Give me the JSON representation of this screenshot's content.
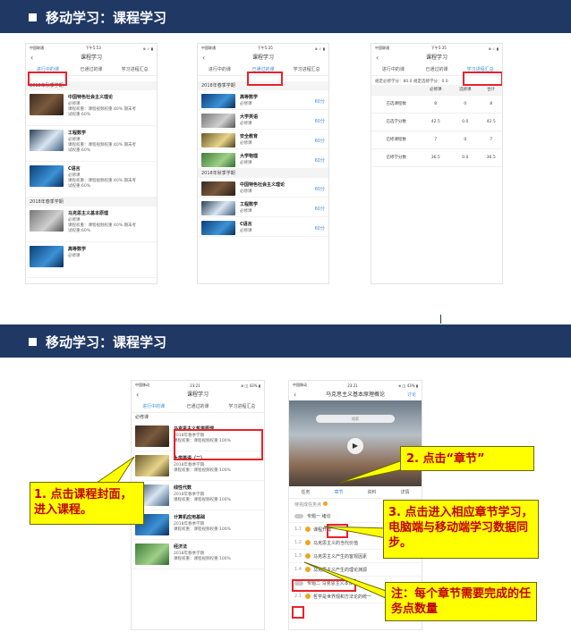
{
  "slide1": {
    "title": "移动学习：课程学习",
    "phone1": {
      "status_left": "中国联通",
      "status_time": "下午5:53",
      "status_right": "⊕ ✓ ▮",
      "nav_title": "课程学习",
      "tabs": [
        "进行中的课",
        "已通过的课",
        "学习进程汇总"
      ],
      "sections": [
        {
          "label": "2018年秋季学期",
          "items": [
            {
              "name": "中国特色社会主义理论",
              "type": "必修课",
              "weight": "课程权重：课程视频权重:40% 期末考",
              "weight2": "试权重:60%",
              "thumb_text": "理论体系概论"
            },
            {
              "name": "工程数学",
              "type": "必修课",
              "weight": "课程权重：课程视频权重:40% 期末考",
              "weight2": "试权重:60%"
            },
            {
              "name": "C语言",
              "type": "必修课",
              "weight": "课程权重：课程视频权重:40% 期末考",
              "weight2": "试权重:60%"
            }
          ]
        },
        {
          "label": "2018年春季学期",
          "items": [
            {
              "name": "马克思主义基本原理",
              "type": "必修课",
              "weight": "课程权重：课程视频权重:40% 期末考",
              "weight2": "试权重:60%",
              "thumb_text": "马克思主义"
            },
            {
              "name": "高等数学",
              "type": "必修课",
              "weight": "",
              "weight2": ""
            }
          ]
        }
      ]
    },
    "phone2": {
      "status_left": "中国联通",
      "status_time": "下午5:35",
      "status_right": "⊕ ✓ ▮",
      "nav_title": "课程学习",
      "tabs": [
        "进行中的课",
        "已通过的课",
        "学习进程汇总"
      ],
      "sections": [
        {
          "label": "2018年春季学期",
          "items": [
            {
              "name": "高等数学",
              "type": "必修课",
              "score": "60分"
            },
            {
              "name": "大学英语",
              "type": "必修课",
              "score": "60分"
            },
            {
              "name": "安全教育",
              "type": "必修课",
              "score": "60分"
            },
            {
              "name": "大学物理",
              "type": "必修课",
              "score": "60分"
            }
          ]
        },
        {
          "label": "2018年秋季学期",
          "items": [
            {
              "name": "中国特色社会主义理论",
              "type": "必修课",
              "score": "60分"
            },
            {
              "name": "工程数学",
              "type": "必修课",
              "score": "60分"
            },
            {
              "name": "C语言",
              "type": "必修课",
              "score": "60分"
            }
          ]
        }
      ]
    },
    "phone3": {
      "status_left": "中国联通",
      "status_time": "下午5:35",
      "status_right": "⊕ ✓ ▮",
      "nav_title": "课程学习",
      "tabs": [
        "进行中的课",
        "已通过的课",
        "学习进程汇总"
      ],
      "summary": "规定必修学分：80.0    规定选修学分：0.0",
      "table": {
        "headers": [
          "",
          "必修课",
          "选修课",
          "合计"
        ],
        "rows": [
          [
            "已选课程数",
            "8",
            "0",
            "8"
          ],
          [
            "已选学分数",
            "42.5",
            "0.0",
            "42.5"
          ],
          [
            "已修课程数",
            "7",
            "0",
            "7"
          ],
          [
            "已修学分数",
            "36.5",
            "0.0",
            "36.5"
          ]
        ]
      }
    }
  },
  "slide2": {
    "title": "移动学习：课程学习",
    "phone4": {
      "status_left": "中国移动",
      "status_time": "23:21",
      "status_right": "⊕ ◫ 43% ▮",
      "nav_title": "课程学习",
      "tabs": [
        "进行中的课",
        "已通过的课",
        "学习进程汇总"
      ],
      "section": "必修课",
      "items": [
        {
          "name": "马克思主义哲学原理",
          "term": "2018年春季学期",
          "weight": "课程权重：课程视频权重:100%"
        },
        {
          "name": "大学英语（二）",
          "term": "2018年春季学期",
          "weight": "课程权重：课程视频权重:100%"
        },
        {
          "name": "线性代数",
          "term": "2018年春季学期",
          "weight": "课程权重：课程视频权重:100%"
        },
        {
          "name": "计算机应用基础",
          "term": "2018年春季学期",
          "weight": "课程权重：课程视频权重:100%"
        },
        {
          "name": "经济法",
          "term": "2018年春季学期",
          "weight": "课程权重：课程视频权重:100%"
        }
      ]
    },
    "phone5": {
      "status_left": "中国移动",
      "status_time": "23:21",
      "status_right": "⊕ ◫ 43% ▮",
      "nav_title": "马克思主义基本原理概论",
      "nav_right": "讨论",
      "search": "搜索",
      "tabs": [
        "任务",
        "章节",
        "资料",
        "详情"
      ],
      "tip": "待完成任务点",
      "rows": [
        {
          "kind": "toggle",
          "text": "专题一 绪论"
        },
        {
          "kind": "dot",
          "num": "1.1",
          "text": "课程开篇"
        },
        {
          "kind": "dot",
          "num": "1.2",
          "text": "马克思主义的当代价值"
        },
        {
          "kind": "dot",
          "num": "1.3",
          "text": "马克思主义产生的客观因素"
        },
        {
          "kind": "dot",
          "num": "1.4",
          "text": "马克思主义产生的理论渊源"
        },
        {
          "kind": "toggle",
          "text": "专题二 马克思主义本体论"
        },
        {
          "kind": "dot",
          "num": "2.1",
          "text": "哲学是世界观和方法论的统一"
        }
      ]
    },
    "callouts": {
      "c1": "1. 点击课程封面，进入课程。",
      "c2": "2. 点击“章节”",
      "c3": "3. 点击进入相应章节学习，电脑端与移动端学习数据同步。",
      "c4": "注：每个章节需要完成的任务点数量"
    }
  }
}
